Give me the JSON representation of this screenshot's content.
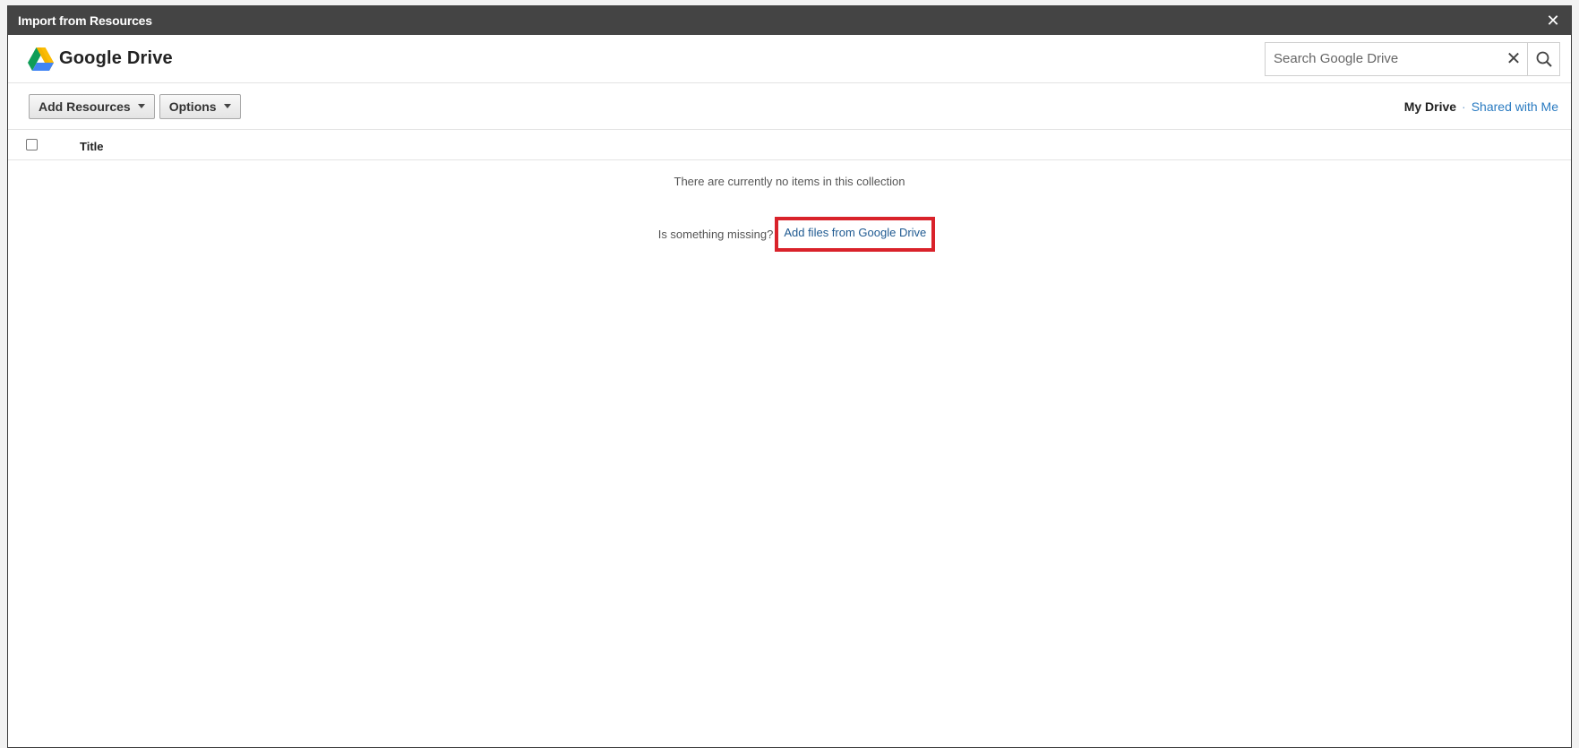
{
  "dialog": {
    "title": "Import from Resources",
    "close_glyph": "✕"
  },
  "header": {
    "brand_name": "Google Drive",
    "brand_icon": "google-drive-icon",
    "search": {
      "placeholder": "Search Google Drive",
      "value": "",
      "clear_glyph": "✕",
      "search_icon": "search-icon"
    }
  },
  "toolbar": {
    "add_resources_label": "Add Resources",
    "options_label": "Options",
    "nav": {
      "my_drive": "My Drive",
      "separator": "·",
      "shared_with_me": "Shared with Me"
    }
  },
  "table": {
    "columns": [
      "Title"
    ]
  },
  "empty_state": {
    "message": "There are currently no items in this collection",
    "missing_text": "Is something missing?",
    "add_link": "Add files from Google Drive"
  },
  "colors": {
    "titlebar": "#444444",
    "link": "#2a7bc1",
    "highlight": "#d9222a"
  }
}
